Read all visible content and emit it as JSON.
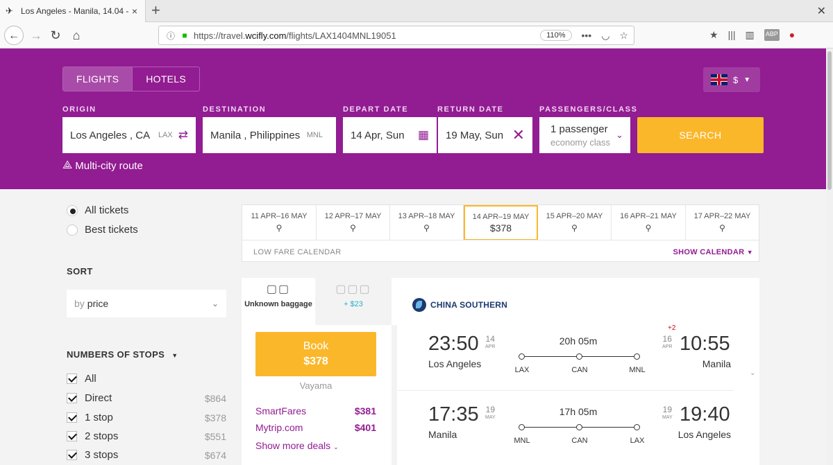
{
  "browser": {
    "tab_title": "Los Angeles - Manila, 14.04 - 1",
    "url_prefix": "https://travel.",
    "url_domain": "wcifly.com",
    "url_path": "/flights/LAX1404MNL19051",
    "zoom": "110%"
  },
  "header": {
    "tabs": [
      {
        "label": "FLIGHTS"
      },
      {
        "label": "HOTELS"
      }
    ],
    "currency": "$",
    "labels": {
      "origin": "ORIGIN",
      "destination": "DESTINATION",
      "depart": "DEPART DATE",
      "return": "RETURN DATE",
      "passengers": "PASSENGERS/CLASS"
    },
    "origin": {
      "value": "Los Angeles , CA",
      "code": "LAX"
    },
    "destination": {
      "value": "Manila , Philippines",
      "code": "MNL"
    },
    "depart": "14 Apr, Sun",
    "return": "19 May, Sun",
    "passengers": "1 passenger",
    "class": "economy class",
    "search_label": "SEARCH",
    "multicity": "Multi-city route"
  },
  "sidebar": {
    "ticket_filters": [
      {
        "label": "All tickets",
        "checked": true
      },
      {
        "label": "Best tickets",
        "checked": false
      }
    ],
    "sort_heading": "SORT",
    "sort_by": "by",
    "sort_value": "price",
    "stops_heading": "NUMBERS OF STOPS",
    "stops": [
      {
        "label": "All",
        "price": ""
      },
      {
        "label": "Direct",
        "price": "$864"
      },
      {
        "label": "1 stop",
        "price": "$378"
      },
      {
        "label": "2 stops",
        "price": "$551"
      },
      {
        "label": "3 stops",
        "price": "$674"
      }
    ]
  },
  "datestrip": {
    "cells": [
      {
        "range": "11 APR–16 MAY",
        "price": ""
      },
      {
        "range": "12 APR–17 MAY",
        "price": ""
      },
      {
        "range": "13 APR–18 MAY",
        "price": ""
      },
      {
        "range": "14 APR–19 MAY",
        "price": "$378",
        "selected": true
      },
      {
        "range": "15 APR–20 MAY",
        "price": ""
      },
      {
        "range": "16 APR–21 MAY",
        "price": ""
      },
      {
        "range": "17 APR–22 MAY",
        "price": ""
      }
    ],
    "low_fare": "LOW FARE CALENDAR",
    "show_calendar": "SHOW CALENDAR"
  },
  "result": {
    "baggage_unknown": "Unknown baggage",
    "baggage_extra": "+ $23",
    "book_label": "Book",
    "book_price": "$378",
    "agency": "Vayama",
    "deals": [
      {
        "name": "SmartFares",
        "price": "$381"
      },
      {
        "name": "Mytrip.com",
        "price": "$401"
      }
    ],
    "more_deals": "Show more deals",
    "airline": "CHINA SOUTHERN",
    "segments": [
      {
        "dep_time": "23:50",
        "dep_day": "14",
        "dep_mon": "APR",
        "dep_city": "Los Angeles",
        "duration": "20h 05m",
        "stops": [
          "LAX",
          "CAN",
          "MNL"
        ],
        "arr_time": "10:55",
        "arr_day": "16",
        "arr_mon": "APR",
        "arr_city": "Manila",
        "plus_days": "+2"
      },
      {
        "dep_time": "17:35",
        "dep_day": "19",
        "dep_mon": "MAY",
        "dep_city": "Manila",
        "duration": "17h 05m",
        "stops": [
          "MNL",
          "CAN",
          "LAX"
        ],
        "arr_time": "19:40",
        "arr_day": "19",
        "arr_mon": "MAY",
        "arr_city": "Los Angeles",
        "plus_days": ""
      }
    ]
  },
  "colors": {
    "brand": "#921c92",
    "accent": "#fbb72a"
  }
}
